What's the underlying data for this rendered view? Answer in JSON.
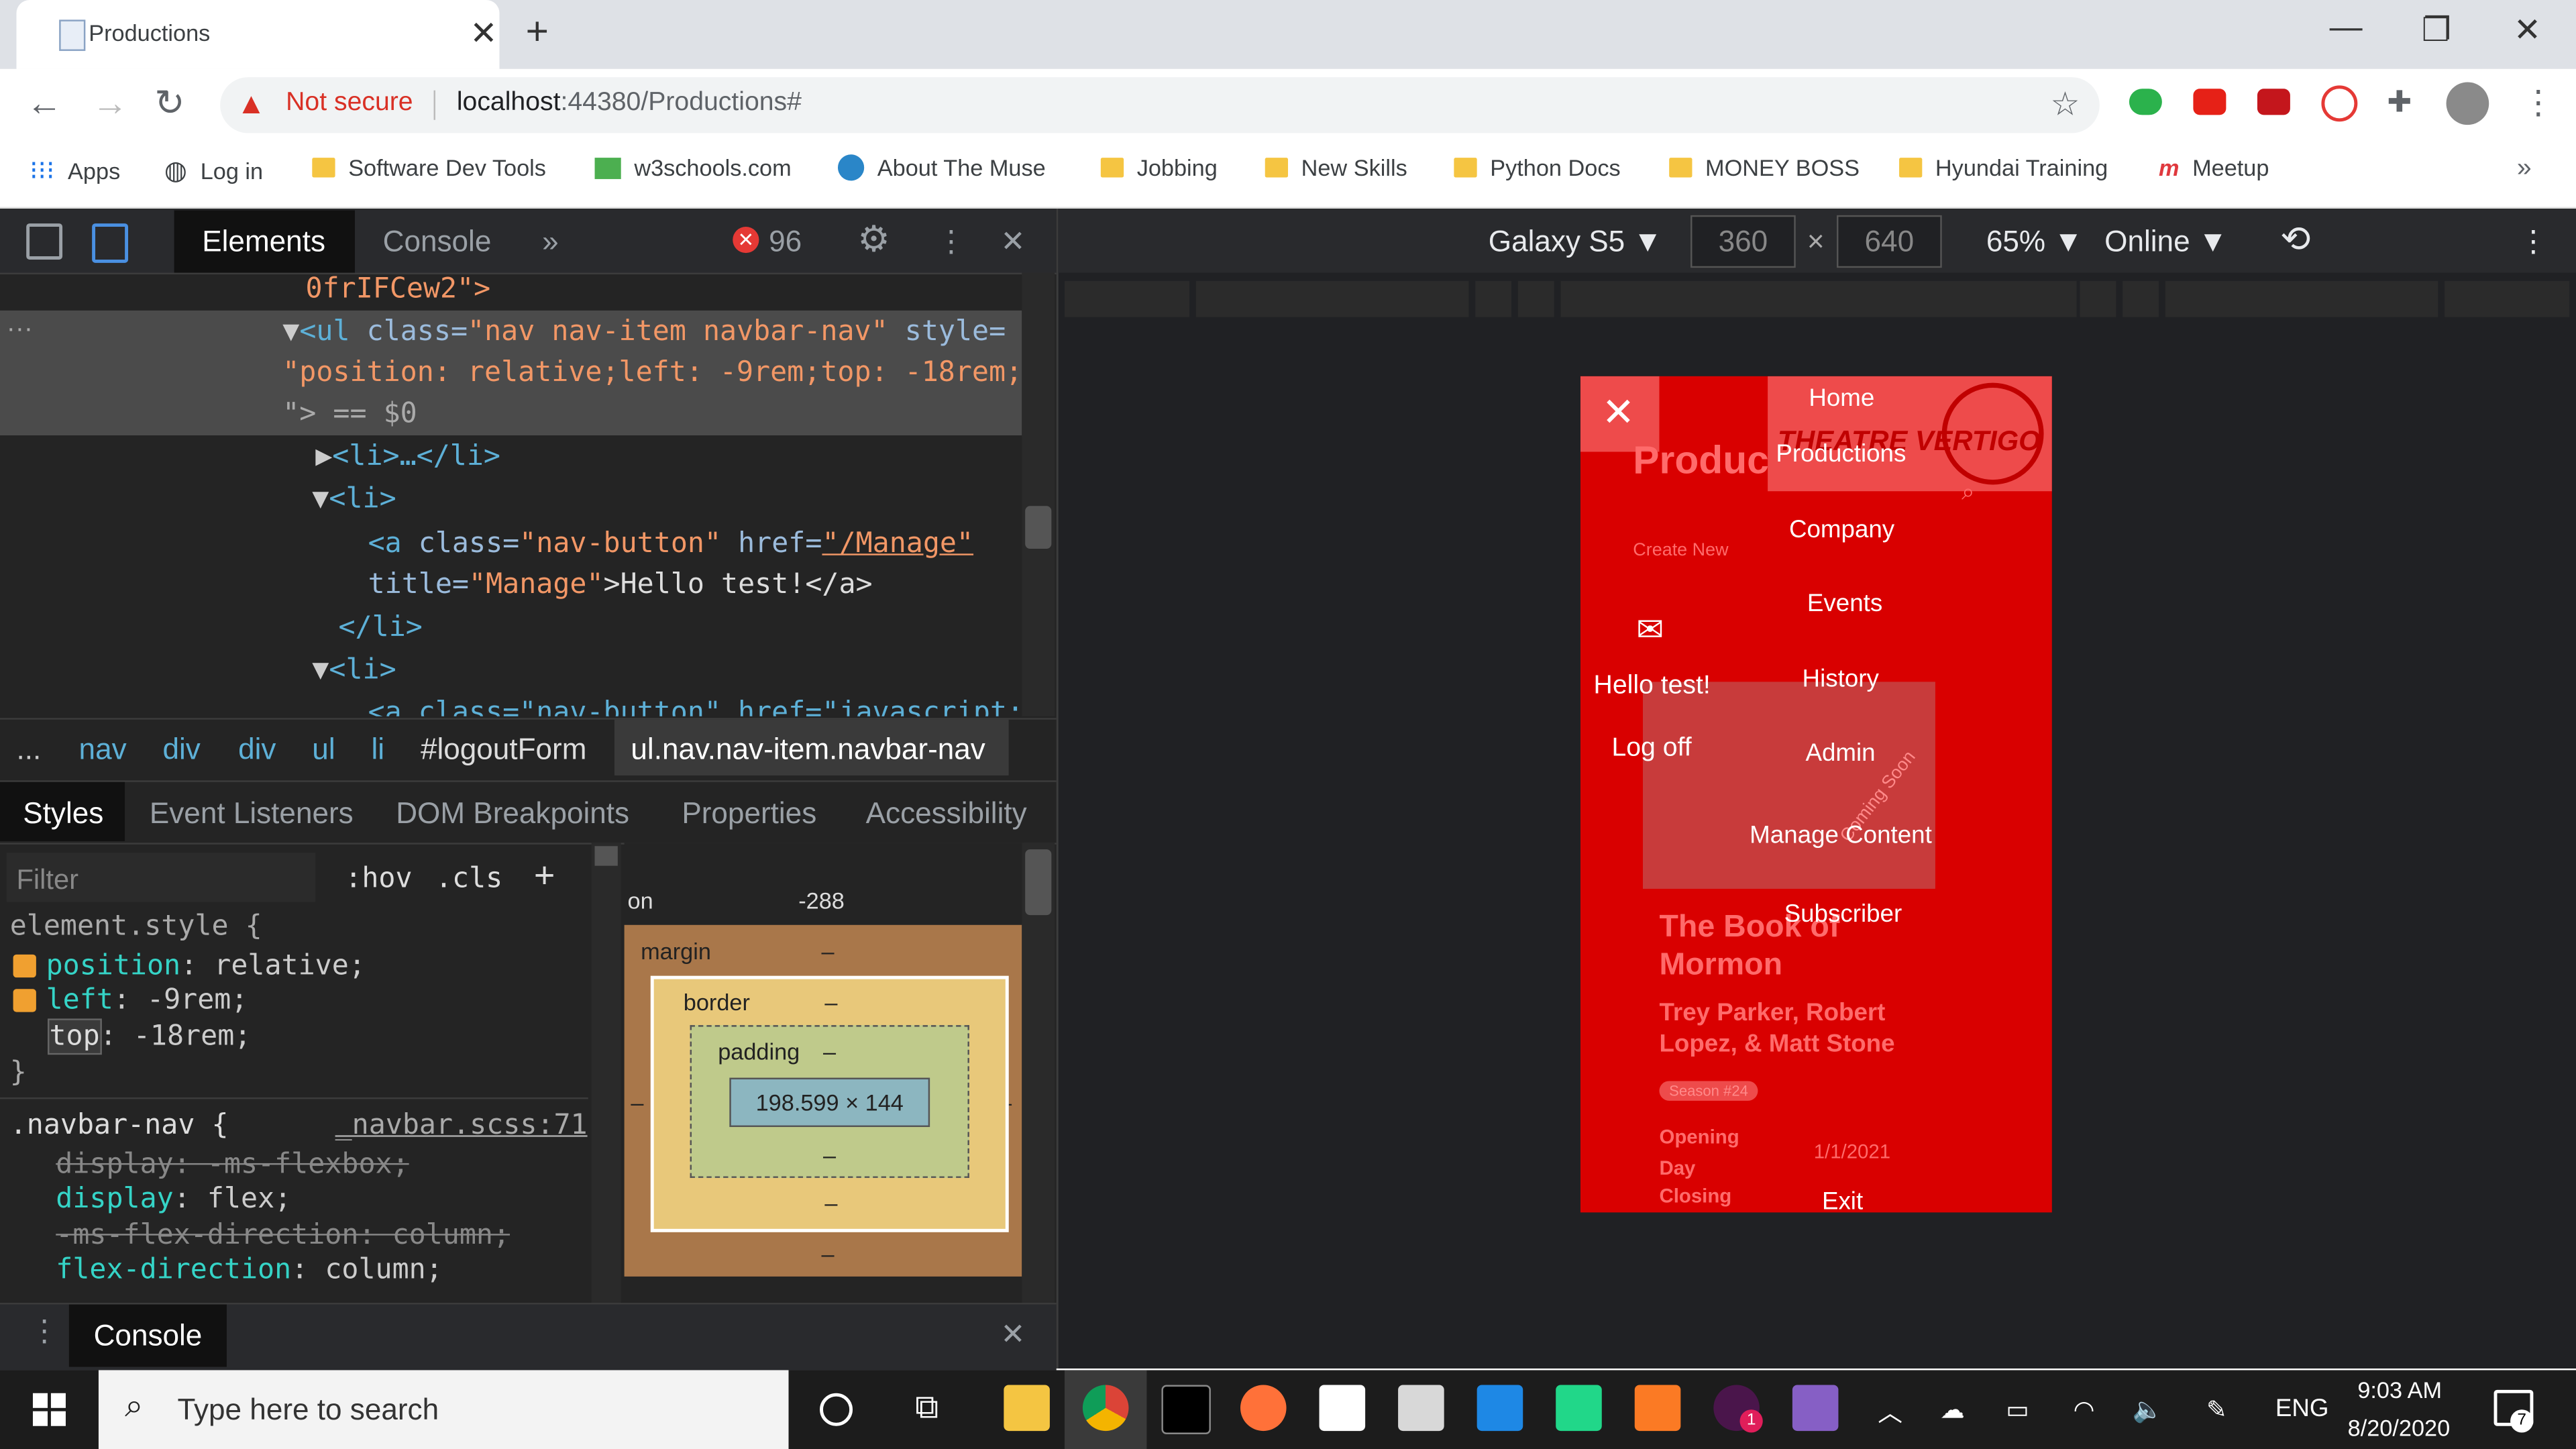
{
  "browser": {
    "tab_title": "Productions",
    "not_secure": "Not secure",
    "url_host": "localhost",
    "url_rest": ":44380/Productions#"
  },
  "bookmarks": [
    "Apps",
    "Log in",
    "Software Dev Tools",
    "w3schools.com",
    "About The Muse",
    "Jobbing",
    "New Skills",
    "Python Docs",
    "MONEY BOSS",
    "Hyundai Training",
    "Meetup"
  ],
  "devtools": {
    "tabs": {
      "elements": "Elements",
      "console": "Console",
      "more": "»"
    },
    "error_count": "96",
    "tree": {
      "line0": "0frIFCew2\">",
      "sel_tag": "<ul ",
      "sel_attr1": "class=",
      "sel_val1": "\"nav nav-item navbar-nav\"",
      "sel_attr2": " style=",
      "sel_val2": "\"position: relative;left: -9rem;top: -18rem;",
      "sel_end": "\"> == $0",
      "line_li1": "<li>…</li>",
      "line_li2": "<li>",
      "line_a_tag": "<a ",
      "line_a_cls": "class=",
      "line_a_clsv": "\"nav-button\"",
      "line_a_href": " href=",
      "line_a_hrefv": "\"/Manage\"",
      "line_a_title": "title=",
      "line_a_titlev": "\"Manage\"",
      "line_a_text": ">Hello test!</a>",
      "line_li_close": "</li>",
      "line_li3": "<li>",
      "line_cut": "<a class=\"nav-button\" href=\"javascript:"
    },
    "breadcrumbs": [
      "...",
      "nav",
      "div",
      "div",
      "ul",
      "li",
      "#logoutForm",
      "ul.nav.nav-item.navbar-nav"
    ],
    "subtabs": [
      "Styles",
      "Event Listeners",
      "DOM Breakpoints",
      "Properties",
      "Accessibility"
    ],
    "filter_placeholder": "Filter",
    "hov": ":hov",
    "cls": ".cls",
    "element_style": {
      "selector": "element.style {",
      "rules": [
        {
          "prop": "position",
          "val": "relative;"
        },
        {
          "prop": "left",
          "val": "-9rem;"
        },
        {
          "prop": "top",
          "val": "-18rem;"
        }
      ],
      "close": "}"
    },
    "navbar_rule": {
      "selector": ".navbar-nav {",
      "source": "_navbar.scss:71",
      "l1": "display: -ms-flexbox;",
      "l2p": "display",
      "l2v": ": flex;",
      "l3": "-ms-flex-direction: column;",
      "l4p": "flex-direction",
      "l4v": ": column;"
    },
    "boxmodel": {
      "position_label": "on",
      "position_val": "-288",
      "margin": "margin",
      "border": "border",
      "padding": "padding",
      "content": "198.599 × 144",
      "dash": "–"
    },
    "drawer_tab": "Console"
  },
  "device": {
    "name": "Galaxy S5",
    "width": "360",
    "height": "640",
    "times": "×",
    "zoom": "65%",
    "network": "Online"
  },
  "phone": {
    "menu": [
      "Home",
      "Productions",
      "Company",
      "Events",
      "History",
      "Admin",
      "Manage Content",
      "Subscriber",
      "Exit"
    ],
    "hello": "Hello test!",
    "logoff": "Log off",
    "page_title": "Produc",
    "create_new": "Create New",
    "logo": "THEATRE VERTIGO",
    "coming_soon": "Coming Soon",
    "show_title": "The Book of Mormon",
    "authors": "Trey Parker, Robert Lopez, & Matt Stone",
    "season": "Season #24",
    "opening": "Opening Day",
    "closing": "Closing",
    "date": "1/1/2021"
  },
  "taskbar": {
    "search_placeholder": "Type here to search",
    "lang": "ENG",
    "time": "9:03 AM",
    "date": "8/20/2020",
    "notif_count": "7",
    "slack_badge": "1"
  }
}
